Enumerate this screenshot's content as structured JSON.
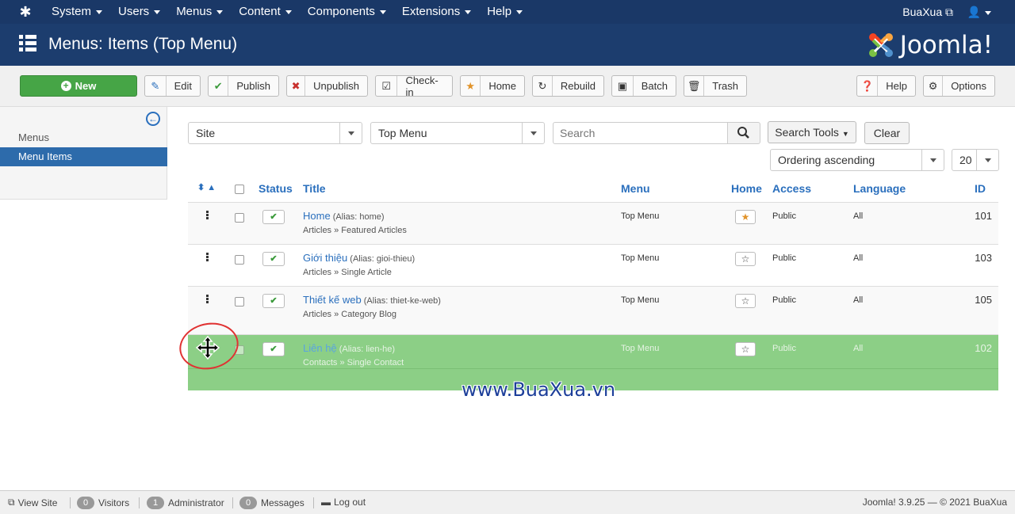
{
  "navbar": {
    "menus": [
      "System",
      "Users",
      "Menus",
      "Content",
      "Components",
      "Extensions",
      "Help"
    ],
    "site_link": "BuaXua",
    "user_icon": "user-icon"
  },
  "header": {
    "title": "Menus: Items (Top Menu)",
    "brand": "Joomla!",
    "brand_colors": [
      "#f44321",
      "#f9a541",
      "#7ac143",
      "#5091cd"
    ]
  },
  "toolbar": {
    "new": "New",
    "edit": "Edit",
    "publish": "Publish",
    "unpublish": "Unpublish",
    "checkin": "Check-in",
    "home": "Home",
    "rebuild": "Rebuild",
    "batch": "Batch",
    "trash": "Trash",
    "help": "Help",
    "options": "Options"
  },
  "sidebar": {
    "items": [
      {
        "label": "Menus",
        "active": false
      },
      {
        "label": "Menu Items",
        "active": true
      }
    ]
  },
  "filters": {
    "client": "Site",
    "menu": "Top Menu",
    "search_placeholder": "Search",
    "search_tools": "Search Tools",
    "clear": "Clear",
    "ordering": "Ordering ascending",
    "limit": "20"
  },
  "table": {
    "headers": {
      "status": "Status",
      "title": "Title",
      "menu": "Menu",
      "home": "Home",
      "access": "Access",
      "language": "Language",
      "id": "ID"
    },
    "rows": [
      {
        "title": "Home",
        "alias": "(Alias: home)",
        "type": "Articles » Featured Articles",
        "menu": "Top Menu",
        "home": true,
        "access": "Public",
        "language": "All",
        "id": "101"
      },
      {
        "title": "Giới thiệu",
        "alias": "(Alias: gioi-thieu)",
        "type": "Articles » Single Article",
        "menu": "Top Menu",
        "home": false,
        "access": "Public",
        "language": "All",
        "id": "103"
      },
      {
        "title": "Thiết kế web",
        "alias": "(Alias: thiet-ke-web)",
        "type": "Articles » Category Blog",
        "menu": "Top Menu",
        "home": false,
        "access": "Public",
        "language": "All",
        "id": "105"
      },
      {
        "title": "Liên hệ",
        "alias": "(Alias: lien-he)",
        "type": "Contacts » Single Contact",
        "menu": "Top Menu",
        "home": false,
        "access": "Public",
        "language": "All",
        "id": "102"
      }
    ]
  },
  "watermark": "www.BuaXua.vn",
  "footer": {
    "view_site": "View Site",
    "visitors_count": "0",
    "visitors": "Visitors",
    "admin_count": "1",
    "administrator": "Administrator",
    "messages_count": "0",
    "messages": "Messages",
    "logout": "Log out",
    "copyright": "Joomla! 3.9.25 — © 2021 BuaXua"
  }
}
